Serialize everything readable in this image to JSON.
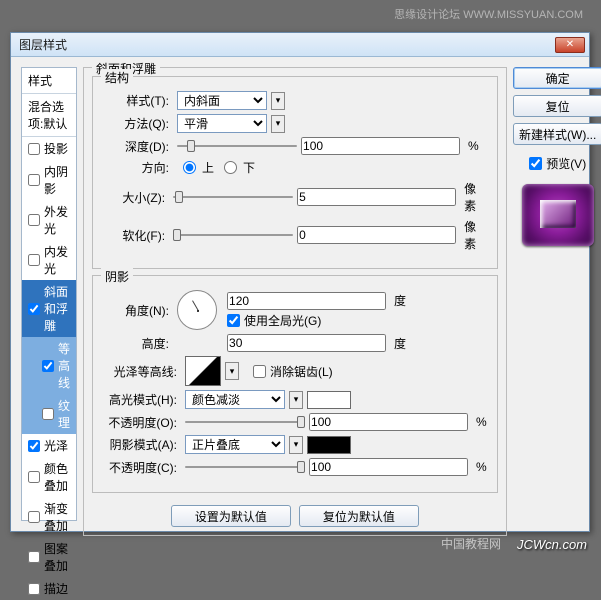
{
  "watermark_top": "思缘设计论坛  WWW.MISSYUAN.COM",
  "watermark_bot": "JCWcn.com",
  "watermark_bot2": "中国教程网",
  "title": "图层样式",
  "sidebar": {
    "styles": "样式",
    "blend": "混合选项:默认",
    "items": [
      {
        "label": "投影",
        "checked": false
      },
      {
        "label": "内阴影",
        "checked": false
      },
      {
        "label": "外发光",
        "checked": false
      },
      {
        "label": "内发光",
        "checked": false
      },
      {
        "label": "斜面和浮雕",
        "checked": true,
        "selected": true
      },
      {
        "label": "等高线",
        "checked": true,
        "sub": true
      },
      {
        "label": "纹理",
        "checked": false,
        "sub": true
      },
      {
        "label": "光泽",
        "checked": true
      },
      {
        "label": "颜色叠加",
        "checked": false
      },
      {
        "label": "渐变叠加",
        "checked": false
      },
      {
        "label": "图案叠加",
        "checked": false
      },
      {
        "label": "描边",
        "checked": false
      }
    ]
  },
  "panel": {
    "main_title": "斜面和浮雕",
    "struct_title": "结构",
    "style_label": "样式(T):",
    "style_value": "内斜面",
    "method_label": "方法(Q):",
    "method_value": "平滑",
    "depth_label": "深度(D):",
    "depth_value": "100",
    "pct": "%",
    "dir_label": "方向:",
    "dir_up": "上",
    "dir_down": "下",
    "size_label": "大小(Z):",
    "size_value": "5",
    "px": "像素",
    "soften_label": "软化(F):",
    "soften_value": "0",
    "shadow_title": "阴影",
    "angle_label": "角度(N):",
    "angle_value": "120",
    "deg": "度",
    "global_label": "使用全局光(G)",
    "alt_label": "高度:",
    "alt_value": "30",
    "gloss_label": "光泽等高线:",
    "anti_label": "消除锯齿(L)",
    "hi_mode_label": "高光模式(H):",
    "hi_mode_value": "颜色减淡",
    "hi_color": "#ffffff",
    "hi_op_label": "不透明度(O):",
    "hi_op_value": "100",
    "sh_mode_label": "阴影模式(A):",
    "sh_mode_value": "正片叠底",
    "sh_color": "#000000",
    "sh_op_label": "不透明度(C):",
    "sh_op_value": "100",
    "set_default": "设置为默认值",
    "reset_default": "复位为默认值"
  },
  "buttons": {
    "ok": "确定",
    "reset": "复位",
    "newstyle": "新建样式(W)...",
    "preview": "预览(V)"
  }
}
